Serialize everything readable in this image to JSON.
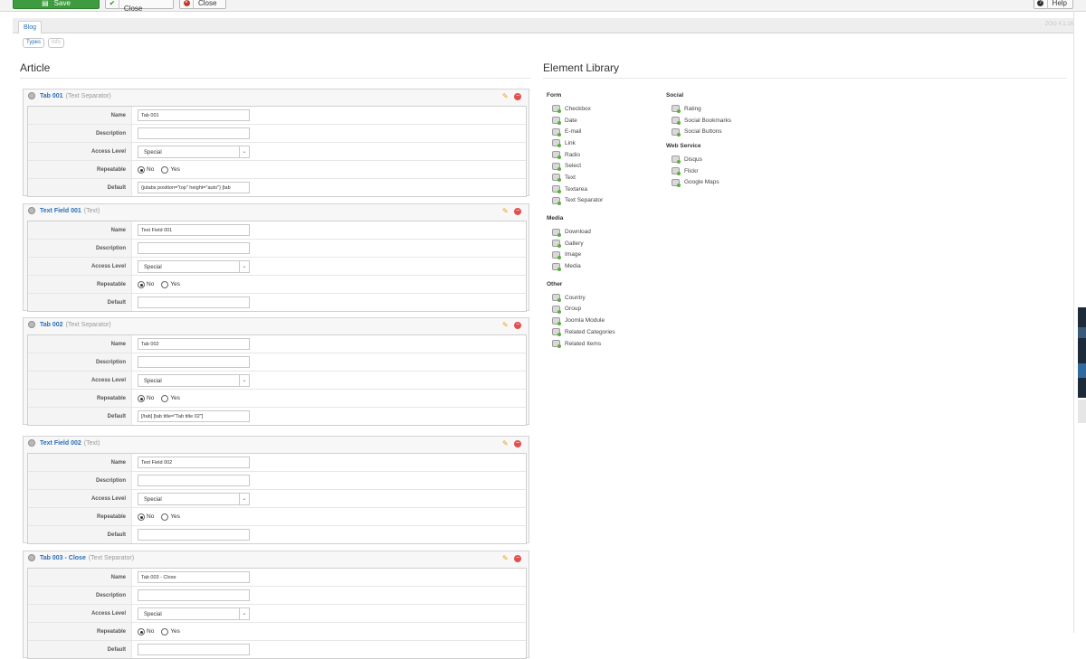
{
  "toolbar": {
    "save_label": "Save",
    "save_close_label": "Save & Close",
    "close_label": "Close",
    "help_label": "Help"
  },
  "tabs": {
    "blog_label": "Blog",
    "version": "ZOO 4.1.16"
  },
  "subtabs": {
    "types_label": "Types",
    "info_label": "Info"
  },
  "article": {
    "heading": "Article",
    "field_labels": {
      "name": "Name",
      "description": "Description",
      "access": "Access Level",
      "repeatable": "Repeatable",
      "default": "Default"
    },
    "radio_labels": {
      "no": "No",
      "yes": "Yes"
    },
    "elements": [
      {
        "name": "Tab 001",
        "type": "(Text Separator)",
        "name_value": "Tab 001",
        "description_value": "",
        "access_value": "Special",
        "default_value": "{jutabs position=\"top\" height=\"auto\"} [tab"
      },
      {
        "name": "Text Field 001",
        "type": "(Text)",
        "name_value": "Text Field 001",
        "description_value": "",
        "access_value": "Special",
        "default_value": ""
      },
      {
        "name": "Tab 002",
        "type": "(Text Separator)",
        "name_value": "Tab 002",
        "description_value": "",
        "access_value": "Special",
        "default_value": "[/tab] [tab title=\"Tab title 02\"]"
      },
      {
        "name": "Text Field 002",
        "type": "(Text)",
        "name_value": "Text Field 002",
        "description_value": "",
        "access_value": "Special",
        "default_value": ""
      },
      {
        "name": "Tab 003 - Close",
        "type": "(Text Separator)",
        "name_value": "Tab 003 - Close",
        "description_value": "",
        "access_value": "Special",
        "default_value": ""
      }
    ]
  },
  "library": {
    "heading": "Element Library",
    "form": {
      "label": "Form",
      "items": [
        "Checkbox",
        "Date",
        "E-mail",
        "Link",
        "Radio",
        "Select",
        "Text",
        "Textarea",
        "Text Separator"
      ]
    },
    "media": {
      "label": "Media",
      "items": [
        "Download",
        "Gallery",
        "Image",
        "Media"
      ]
    },
    "other": {
      "label": "Other",
      "items": [
        "Country",
        "Group",
        "Joomla Module",
        "Related Categories",
        "Related Items"
      ]
    },
    "social": {
      "label": "Social",
      "items": [
        "Rating",
        "Social Bookmarks",
        "Social Buttons"
      ]
    },
    "webservice": {
      "label": "Web Service",
      "items": [
        "Disqus",
        "Flickr",
        "Google Maps"
      ]
    }
  },
  "icons": {
    "save": "save-icon",
    "save_close": "check-icon",
    "close": "close-icon",
    "help": "help-icon",
    "element": "gear-icon",
    "edit": "pencil-icon",
    "delete": "delete-icon",
    "library_item": "element-add-icon"
  },
  "colors": {
    "save_green": "#3f9b3f",
    "link_blue": "#2a6fb8",
    "delete_red": "#e05050",
    "edit_orange": "#e3a21a"
  }
}
